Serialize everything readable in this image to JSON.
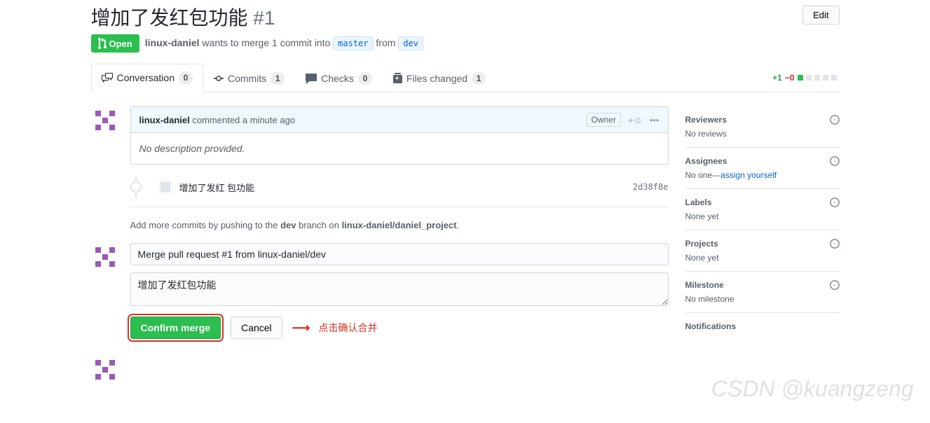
{
  "header": {
    "title": "增加了发红包功能",
    "issue_number": "#1",
    "edit_label": "Edit"
  },
  "state": {
    "label": "Open",
    "author": "linux-daniel",
    "merge_text_1": "wants to merge 1 commit into",
    "base_branch": "master",
    "merge_text_2": "from",
    "head_branch": "dev"
  },
  "tabs": {
    "conversation": {
      "label": "Conversation",
      "count": "0"
    },
    "commits": {
      "label": "Commits",
      "count": "1"
    },
    "checks": {
      "label": "Checks",
      "count": "0"
    },
    "files": {
      "label": "Files changed",
      "count": "1"
    }
  },
  "diffstat": {
    "add": "+1",
    "del": "−0"
  },
  "comment": {
    "author": "linux-daniel",
    "action": "commented a minute ago",
    "owner_label": "Owner",
    "body": "No description provided."
  },
  "commit": {
    "msg": "增加了发红 包功能",
    "sha": "2d38f8e"
  },
  "push_hint": {
    "pre": "Add more commits by pushing to the ",
    "branch": "dev",
    "mid": " branch on ",
    "repo": "linux-daniel/daniel_project",
    "post": "."
  },
  "merge": {
    "title_value": "Merge pull request #1 from linux-daniel/dev",
    "desc_value": "增加了发红包功能",
    "confirm_label": "Confirm merge",
    "cancel_label": "Cancel"
  },
  "annotation": {
    "text": "点击确认合并"
  },
  "sidebar": {
    "reviewers": {
      "title": "Reviewers",
      "val": "No reviews"
    },
    "assignees": {
      "title": "Assignees",
      "pre": "No one—",
      "link": "assign yourself"
    },
    "labels": {
      "title": "Labels",
      "val": "None yet"
    },
    "projects": {
      "title": "Projects",
      "val": "None yet"
    },
    "milestone": {
      "title": "Milestone",
      "val": "No milestone"
    },
    "notifications": {
      "title": "Notifications"
    }
  },
  "watermark": "CSDN @kuangzeng"
}
